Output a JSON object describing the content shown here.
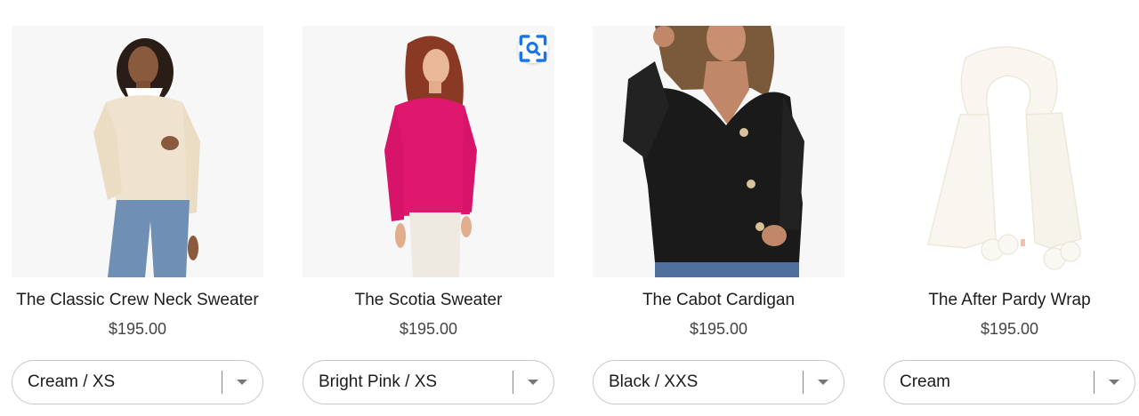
{
  "products": [
    {
      "title": "The Classic Crew Neck Sweater",
      "price": "$195.00",
      "variant": "Cream / XS"
    },
    {
      "title": "The Scotia Sweater",
      "price": "$195.00",
      "variant": "Bright Pink / XS"
    },
    {
      "title": "The Cabot Cardigan",
      "price": "$195.00",
      "variant": "Black / XXS"
    },
    {
      "title": "The After Pardy Wrap",
      "price": "$195.00",
      "variant": "Cream"
    }
  ],
  "icons": {
    "lens": "lens-scan-icon",
    "dropdown": "chevron-down-icon"
  },
  "colors": {
    "cream": "#efe3cf",
    "bright_pink": "#e0176f",
    "black": "#1a1a1a",
    "wrap_cream": "#f8f6ef"
  }
}
